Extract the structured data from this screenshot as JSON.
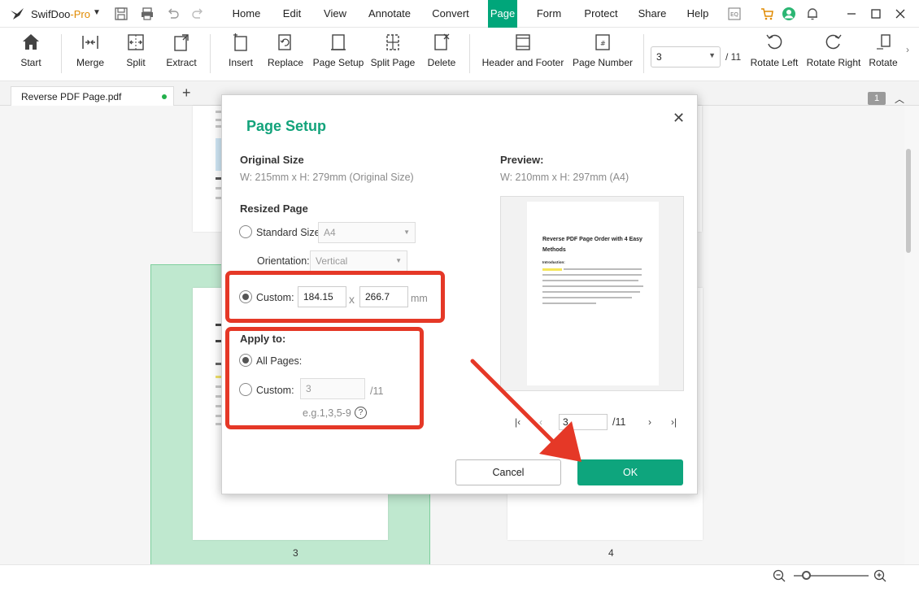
{
  "app": {
    "name": "SwifDoo",
    "name_suffix": "-Pro"
  },
  "menu": [
    "Home",
    "Edit",
    "View",
    "Annotate",
    "Convert",
    "Page",
    "Form",
    "Protect",
    "Share",
    "Help"
  ],
  "ribbon": {
    "start": "Start",
    "merge": "Merge",
    "split": "Split",
    "extract": "Extract",
    "insert": "Insert",
    "replace": "Replace",
    "page_setup": "Page Setup",
    "split_page": "Split Page",
    "delete": "Delete",
    "header_footer": "Header and Footer",
    "page_number": "Page Number",
    "current_page": "3",
    "total_pages": "/ 11",
    "rotate_left": "Rotate Left",
    "rotate_right": "Rotate Right",
    "rotate": "Rotate"
  },
  "tabs": {
    "doc_name": "Reverse PDF Page.pdf",
    "add": "+",
    "page_badge": "1"
  },
  "workspace": {
    "page3_label": "3",
    "page4_label": "4"
  },
  "dialog": {
    "title": "Page Setup",
    "original_size_label": "Original Size",
    "original_size_value": "W: 215mm x H: 279mm (Original Size)",
    "preview_label": "Preview:",
    "preview_size_value": "W: 210mm x H: 297mm (A4)",
    "resized_page_label": "Resized Page",
    "standard_size_label": "Standard Size:",
    "standard_size_value": "A4",
    "orientation_label": "Orientation:",
    "orientation_value": "Vertical",
    "custom_label": "Custom:",
    "custom_width": "184.15",
    "custom_x": "x",
    "custom_height": "266.7",
    "unit": "mm",
    "apply_to_label": "Apply to:",
    "all_pages_label": "All Pages:",
    "custom_pages_label": "Custom:",
    "custom_pages_value": "3",
    "custom_pages_total": "/11",
    "custom_pages_hint": "e.g.1,3,5-9",
    "help": "?",
    "preview_page_value": "3",
    "preview_page_total": "/11",
    "preview_doc_title": "Reverse PDF Page Order with 4 Easy Methods",
    "preview_intro": "Introduction:",
    "cancel": "Cancel",
    "ok": "OK"
  },
  "colors": {
    "accent": "#00a67a",
    "annotation_red": "#e53827"
  }
}
